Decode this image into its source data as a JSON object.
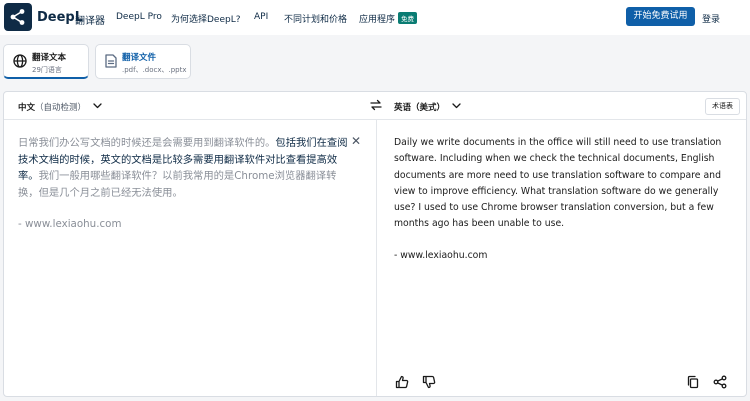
{
  "nav": {
    "brand": "DeepL",
    "brand_sub": "翻译器",
    "items": [
      "DeepL Pro",
      "为何选择DeepL?",
      "API",
      "不同计划和价格",
      "应用程序"
    ],
    "badge": "免费",
    "cta": "开始免费试用",
    "login": "登录"
  },
  "modes": [
    {
      "title": "翻译文本",
      "subtitle": "29门语言",
      "icon": "globe-icon"
    },
    {
      "title": "翻译文件",
      "subtitle": ".pdf、.docx、.pptx",
      "icon": "document-icon"
    }
  ],
  "translator": {
    "source_lang": "中文",
    "source_detect": "（自动检测）",
    "target_lang": "英语（美式）",
    "glossary_label": "术语表",
    "source_text": {
      "dim_1": "日常我们办公写文档的时候还是会需要用到翻译软件的。",
      "highlight": "包括我们在查阅技术文档的时候，英文的文档是比较多需要用翻译软件对比查看提高效率。",
      "dim_2": "我们一般用哪些翻译软件？以前我常用的是Chrome浏览器翻译转换，但是几个月之前已经无法使用。",
      "credit": "- www.lexiaohu.com"
    },
    "target_text": {
      "paragraph": "Daily we write documents in the office will still need to use translation software. Including when we check the technical documents, English documents are more need to use translation software to compare and view to improve efficiency. What translation software do we generally use? I used to use Chrome browser translation conversion, but a few months ago has been unable to use.",
      "credit": "- www.lexiaohu.com"
    }
  },
  "colors": {
    "navy": "#0f2b46",
    "cta_blue": "#0f5fa8",
    "badge_green": "#0a7c73"
  }
}
